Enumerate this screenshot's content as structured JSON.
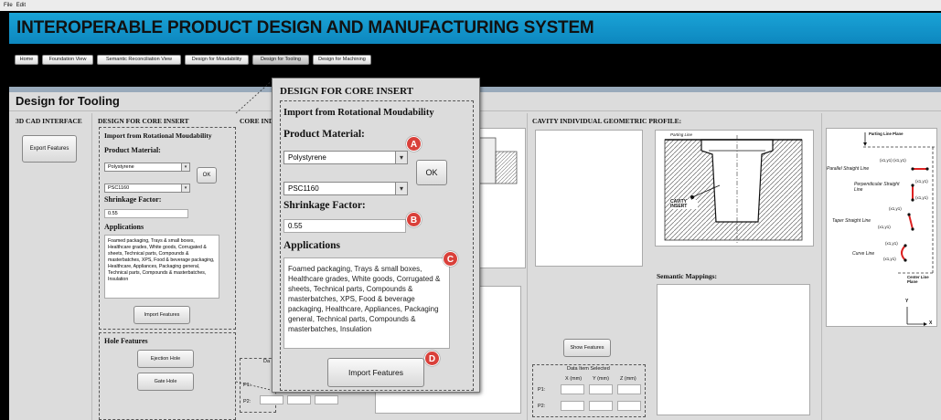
{
  "menu": {
    "file": "File",
    "edit": "Edit"
  },
  "app_title": "INTEROPERABLE PRODUCT DESIGN AND MANUFACTURING SYSTEM",
  "nav": [
    "Home",
    "Foundation View",
    "Semantic Reconciliation View",
    "Design for Moudability",
    "Design for Tooling",
    "Design for Machining"
  ],
  "page_title": "Design for Tooling",
  "cad": {
    "header": "3D CAD INTERFACE",
    "export_button": "Export Features"
  },
  "core_insert": {
    "header": "DESIGN FOR CORE INSERT",
    "import_header": "Import from Rotational Moudability",
    "product_material_label": "Product Material:",
    "material_value": "Polystyrene",
    "grade_value": "PSC1160",
    "ok_label": "OK",
    "shrinkage_label": "Shrinkage Factor:",
    "shrinkage_value": "0.55",
    "applications_label": "Applications",
    "applications_text": "Foamed packaging, Trays & small boxes, Healthcare grades, White goods, Corrugated & sheets, Technical parts, Compounds & masterbatches, XPS, Food & beverage packaging, Healthcare, Appliances, Packaging general, Technical parts, Compounds & masterbatches, Insulation",
    "import_button": "Import Features"
  },
  "hole_features": {
    "header": "Hole Features",
    "ejection": "Ejection Hole",
    "gate": "Gate Hole"
  },
  "core_individual_header": "CORE INDI",
  "cavity": {
    "header": "CAVITY INDIVIDUAL GEOMETRIC PROFILE:",
    "semantic_mappings": "Semantic Mappings:",
    "show_features": "Show Features"
  },
  "data_item": {
    "title": "Data Item Selected",
    "x": "X (mm)",
    "y": "Y (mm)",
    "z": "Z (mm)",
    "p1": "P1:",
    "p2": "P2:",
    "partial_title": "Da"
  },
  "cavity_diagram": {
    "parting_line": "Parting Line",
    "cavity_insert": "CAVITY INSERT"
  },
  "parting_diagram": {
    "parting_line_plane": "Parting Line Plane",
    "parallel": "Parallel Straight Line",
    "perpendicular": "Perpendicular Straight Line",
    "taper": "Taper Straight Line",
    "curve": "Curve Line",
    "center_line_plane": "Center Line Plane",
    "coords_parallel": "(x1,y1) (x1,y1)",
    "coords_perp1": "(x1,y1)",
    "coords_perp2": "(x1,y1)",
    "coords_taper1": "(x1,y1)",
    "coords_taper2": "(x1,y1)",
    "coords_curve1": "(x1,y1)",
    "coords_curve2": "(x1,y1)",
    "axis_y": "Y",
    "axis_x": "X"
  },
  "zoom": {
    "header": "DESIGN FOR CORE INSERT",
    "import_header": "Import from Rotational Moudability",
    "product_material_label": "Product Material:",
    "material_value": "Polystyrene",
    "grade_value": "PSC1160",
    "ok_label": "OK",
    "shrinkage_label": "Shrinkage Factor:",
    "shrinkage_value": "0.55",
    "applications_label": "Applications",
    "applications_text": "Foamed packaging, Trays & small boxes, Healthcare grades, White goods, Corrugated & sheets, Technical parts, Compounds & masterbatches, XPS, Food & beverage packaging, Healthcare, Appliances, Packaging general, Technical parts, Compounds & masterbatches, Insulation",
    "import_button": "Import Features",
    "badges": [
      "A",
      "B",
      "C",
      "D"
    ]
  },
  "colors": {
    "title_bar": "#1aa3d6",
    "badge": "#d9403a",
    "panel": "#dcdcdc"
  }
}
